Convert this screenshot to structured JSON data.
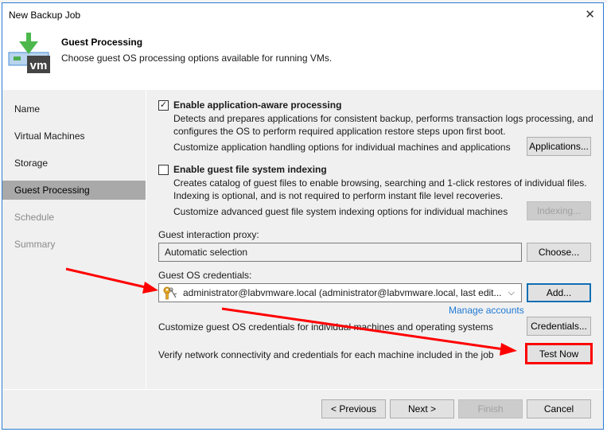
{
  "window": {
    "title": "New Backup Job",
    "close_icon": "close-icon"
  },
  "header": {
    "title": "Guest Processing",
    "subtitle": "Choose guest OS processing options available for running VMs.",
    "icon": "vm-backup-icon"
  },
  "sidebar": {
    "items": [
      {
        "label": "Name",
        "state": "normal"
      },
      {
        "label": "Virtual Machines",
        "state": "normal"
      },
      {
        "label": "Storage",
        "state": "normal"
      },
      {
        "label": "Guest Processing",
        "state": "active"
      },
      {
        "label": "Schedule",
        "state": "disabled"
      },
      {
        "label": "Summary",
        "state": "disabled"
      }
    ]
  },
  "app_aware": {
    "checked": true,
    "check_glyph": "✓",
    "label": "Enable application-aware processing",
    "desc1": "Detects and prepares applications for consistent backup, performs transaction logs processing, and",
    "desc2": "configures the OS to perform required application restore steps upon first boot.",
    "customize": "Customize application handling options for individual machines and applications",
    "button": "Applications..."
  },
  "indexing": {
    "checked": false,
    "label": "Enable guest file system indexing",
    "desc1": "Creates catalog of guest files to enable browsing, searching and 1-click restores of individual files.",
    "desc2": "Indexing is optional, and is not required to perform instant file level recoveries.",
    "customize": "Customize advanced guest file system indexing options for individual machines",
    "button": "Indexing...",
    "button_disabled": true
  },
  "proxy": {
    "label": "Guest interaction proxy:",
    "value": "Automatic selection",
    "button": "Choose..."
  },
  "credentials": {
    "label": "Guest OS credentials:",
    "value": "administrator@labvmware.local (administrator@labvmware.local, last edit...",
    "icon": "key-icon",
    "add_button": "Add...",
    "manage_link": "Manage accounts",
    "customize": "Customize guest OS credentials for individual machines and operating systems",
    "customize_button": "Credentials..."
  },
  "test": {
    "text": "Verify network connectivity and credentials for each machine included in the job",
    "button": "Test Now"
  },
  "footer": {
    "previous": "< Previous",
    "next": "Next >",
    "finish": "Finish",
    "cancel": "Cancel"
  },
  "annotations": {
    "color": "#ff0000",
    "arrows": [
      "arrow-to-credentials-combo",
      "arrow-to-test-now"
    ]
  }
}
